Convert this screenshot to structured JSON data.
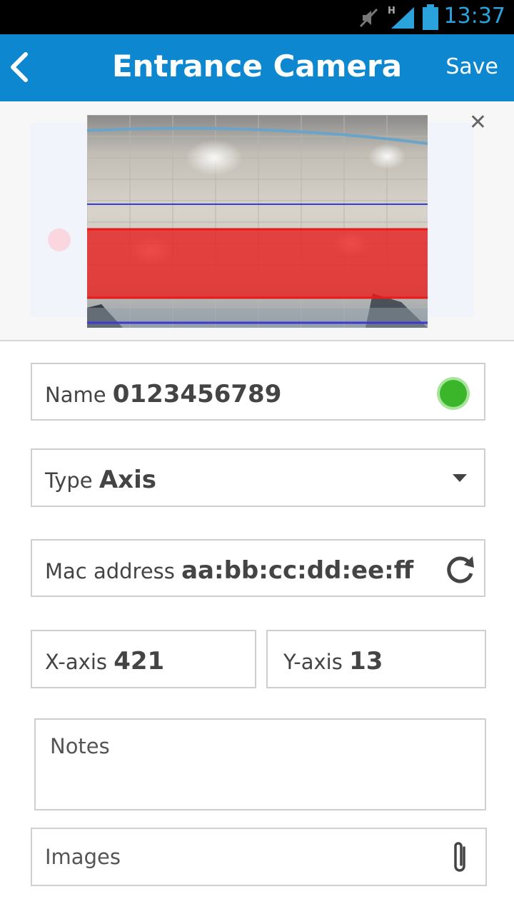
{
  "status_bar": {
    "time": "13:37",
    "icons": [
      "mute-icon",
      "signal-h-icon",
      "battery-icon"
    ]
  },
  "app_bar": {
    "title": "Entrance Camera",
    "save_label": "Save",
    "back_icon": "chevron-left-icon",
    "color": "#0d87cf"
  },
  "preview": {
    "close_icon": "close-icon",
    "zone_colors": {
      "detection": "#e81a1a",
      "boundary": "#3a3ad6"
    }
  },
  "form": {
    "name": {
      "label": "Name",
      "value": "0123456789",
      "status_color": "#3bb62a"
    },
    "type": {
      "label": "Type",
      "value": "Axis"
    },
    "mac": {
      "label": "Mac address",
      "value": "aa:bb:cc:dd:ee:ff",
      "icon": "refresh-icon"
    },
    "x_axis": {
      "label": "X-axis",
      "value": "421"
    },
    "y_axis": {
      "label": "Y-axis",
      "value": "13"
    },
    "notes": {
      "placeholder": "Notes"
    },
    "images": {
      "label": "Images",
      "icon": "paperclip-icon"
    }
  }
}
